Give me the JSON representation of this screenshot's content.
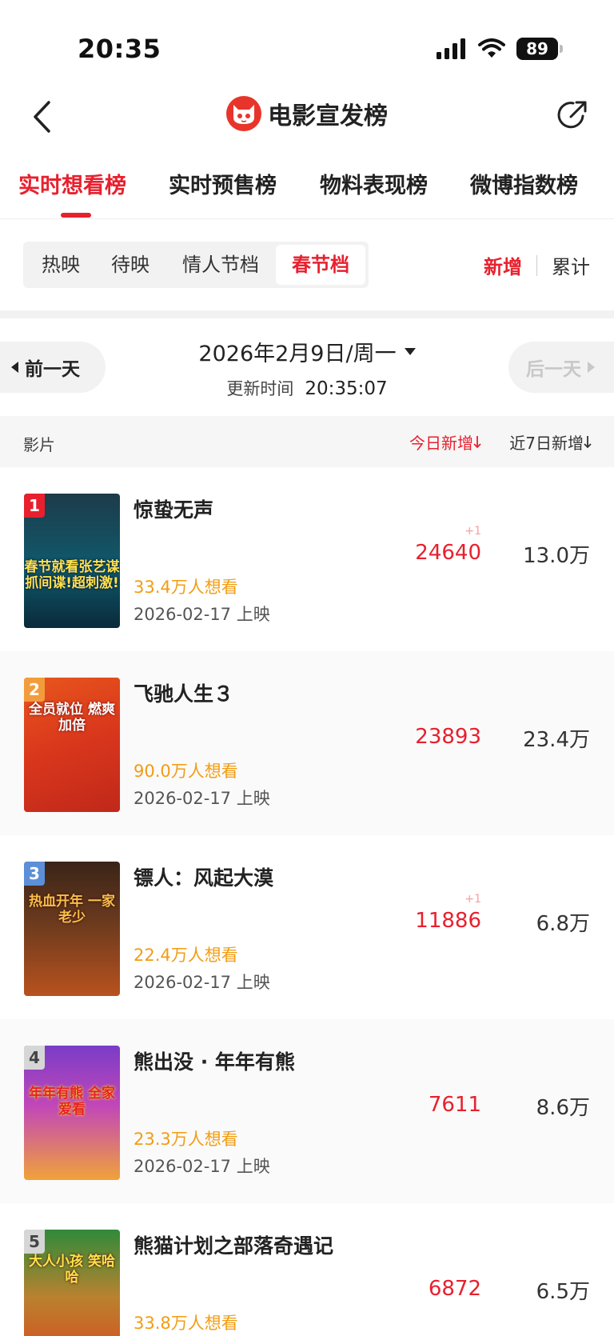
{
  "status_bar": {
    "time": "20:35",
    "battery": "89"
  },
  "nav": {
    "title": "电影宣发榜"
  },
  "main_tabs": [
    {
      "label": "实时想看榜",
      "active": true
    },
    {
      "label": "实时预售榜",
      "active": false
    },
    {
      "label": "物料表现榜",
      "active": false
    },
    {
      "label": "微博指数榜",
      "active": false
    }
  ],
  "sub_filter": [
    {
      "label": "热映",
      "active": false
    },
    {
      "label": "待映",
      "active": false
    },
    {
      "label": "情人节档",
      "active": false
    },
    {
      "label": "春节档",
      "active": true
    }
  ],
  "toggle": {
    "selected": "新增",
    "other": "累计"
  },
  "date_nav": {
    "prev_label": "前一天",
    "next_label": "后一天",
    "date": "2026年2月9日/周一",
    "update_label": "更新时间",
    "update_time": "20:35:07"
  },
  "columns": {
    "film": "影片",
    "today": "今日新增",
    "week": "近7日新增"
  },
  "movies": [
    {
      "rank": "1",
      "title": "惊蛰无声",
      "want": "33.4万人想看",
      "release": "2026-02-17 上映",
      "today": "24640",
      "delta": "+1",
      "week": "13.0万",
      "poster_text": "春节就看张艺谋 抓间谍!超刺激!"
    },
    {
      "rank": "2",
      "title": "飞驰人生３",
      "want": "90.0万人想看",
      "release": "2026-02-17 上映",
      "today": "23893",
      "delta": "",
      "week": "23.4万",
      "poster_text": "全员就位 燃爽加倍"
    },
    {
      "rank": "3",
      "title": "镖人：风起大漠",
      "want": "22.4万人想看",
      "release": "2026-02-17 上映",
      "today": "11886",
      "delta": "+1",
      "week": "6.8万",
      "poster_text": "热血开年 一家老少"
    },
    {
      "rank": "4",
      "title": "熊出没 · 年年有熊",
      "want": "23.3万人想看",
      "release": "2026-02-17 上映",
      "today": "7611",
      "delta": "",
      "week": "8.6万",
      "poster_text": "年年有熊 全家爱看"
    },
    {
      "rank": "5",
      "title": "熊猫计划之部落奇遇记",
      "want": "33.8万人想看",
      "release": "",
      "today": "6872",
      "delta": "",
      "week": "6.5万",
      "poster_text": "大人小孩 笑哈哈"
    }
  ],
  "colors": {
    "accent": "#e8202e",
    "want": "#f39c12"
  }
}
